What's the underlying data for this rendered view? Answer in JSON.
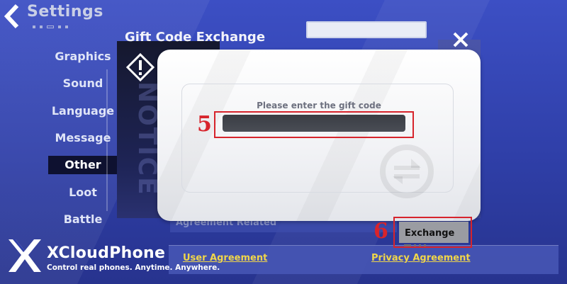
{
  "header": {
    "title": "Settings"
  },
  "sidebar": {
    "items": [
      {
        "label": "Graphics"
      },
      {
        "label": "Sound"
      },
      {
        "label": "Language"
      },
      {
        "label": "Message"
      },
      {
        "label": "Other",
        "active": true
      },
      {
        "label": "Loot"
      },
      {
        "label": "Battle"
      }
    ]
  },
  "dialog": {
    "title": "Gift Code Exchange",
    "side_word": "NOTICE",
    "input_label": "Please enter the gift code",
    "input_value": ""
  },
  "settings_section": {
    "label": "Agreement Related"
  },
  "exchange": {
    "label": "Exchange"
  },
  "links": {
    "user_agreement": "User Agreement",
    "privacy_agreement": "Privacy Agreement"
  },
  "annotations": {
    "step_input": "5",
    "step_exchange": "6"
  },
  "brand": {
    "name": "XCloudPhone",
    "tagline": "Control real phones. Anytime. Anywhere."
  },
  "colors": {
    "accent_red": "#d7242c",
    "link_yellow": "#f0d64a",
    "background_blue": "#2f3fa8"
  }
}
